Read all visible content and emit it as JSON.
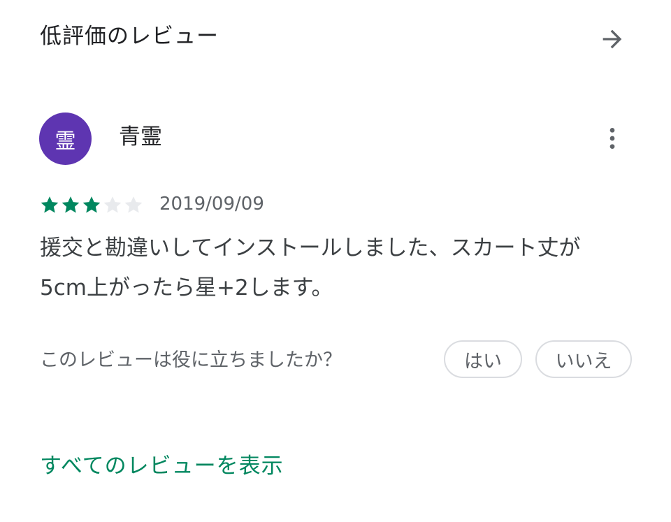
{
  "section": {
    "title": "低評価のレビュー",
    "arrow_icon": "arrow-right-icon"
  },
  "review": {
    "avatar_char": "霊",
    "avatar_color": "#5e35b1",
    "reviewer_name": "青霊",
    "more_icon": "more-vert-icon",
    "rating": 3,
    "max_rating": 5,
    "star_filled_color": "#01875f",
    "star_empty_color": "#e8eaed",
    "date": "2019/09/09",
    "text_line1": "援交と勘違いしてインストールしました、スカート丈が",
    "text_line2": "5cm上がったら星+2します。"
  },
  "helpful": {
    "prompt": "このレビューは役に立ちましたか？",
    "yes_label": "はい",
    "no_label": "いいえ"
  },
  "footer": {
    "all_reviews_link": "すべてのレビューを表示",
    "link_color": "#01875f"
  }
}
